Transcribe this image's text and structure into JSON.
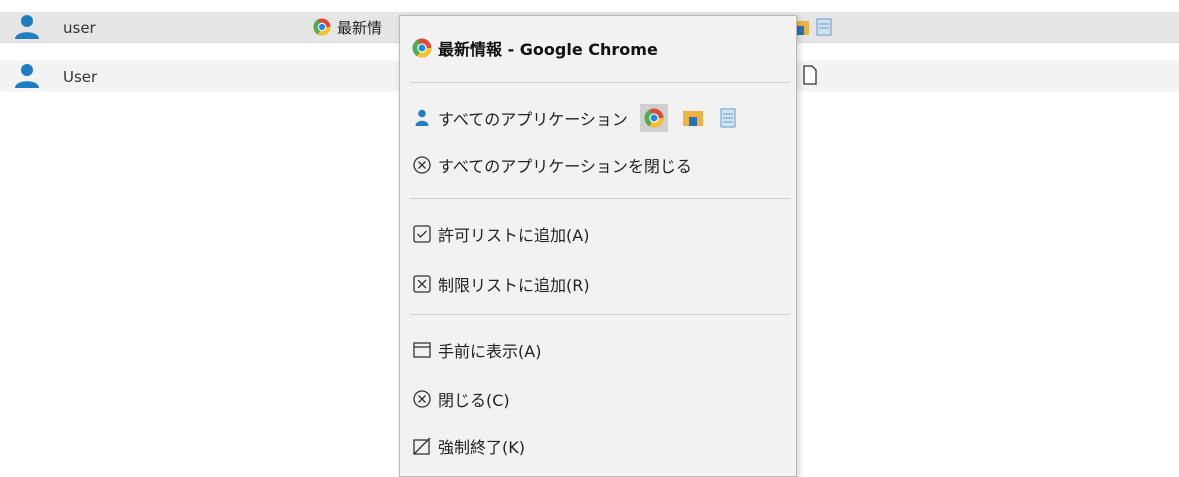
{
  "rows": [
    {
      "user": "user",
      "app_label": "最新情"
    },
    {
      "user": "User"
    }
  ],
  "menu": {
    "header": "最新情報 - Google Chrome",
    "all_apps": "すべてのアプリケーション",
    "close_all_apps": "すべてのアプリケーションを閉じる",
    "add_allow_list": "許可リストに追加(A)",
    "add_block_list": "制限リストに追加(R)",
    "bring_to_front": "手前に表示(A)",
    "close": "閉じる(C)",
    "force_quit": "強制終了(K)"
  },
  "colors": {
    "user_icon": "#1f7dc1",
    "selection": "#cfcfcf"
  }
}
